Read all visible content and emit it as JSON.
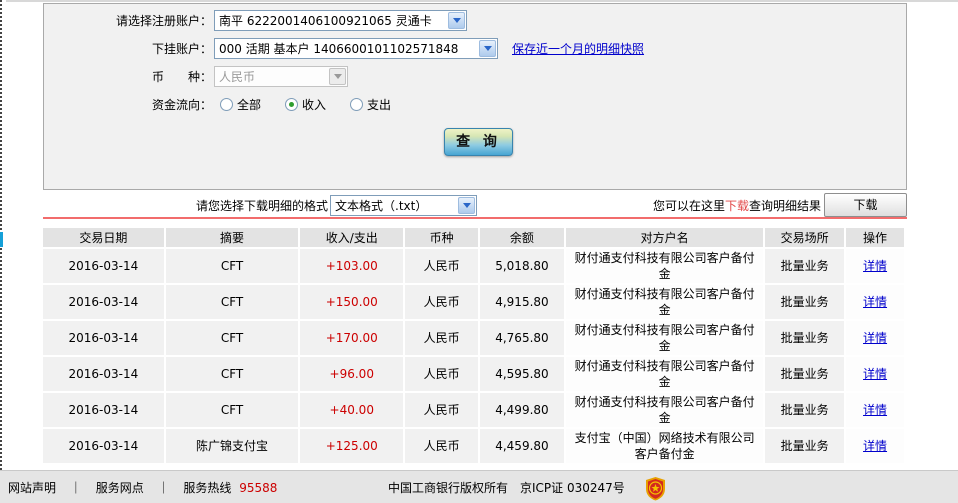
{
  "form": {
    "register_account_label": "请选择注册账户：",
    "register_account_value": "南平 6222001406100921065 灵通卡",
    "sub_account_label": "下挂账户：",
    "sub_account_value": "000 活期 基本户 1406600101102571848",
    "snapshot_link": "保存近一个月的明细快照",
    "currency_label": "币　　种：",
    "currency_value": "人民币",
    "flow_label": "资金流向：",
    "flow_options": [
      {
        "label": "全部",
        "selected": false
      },
      {
        "label": "收入",
        "selected": true
      },
      {
        "label": "支出",
        "selected": false
      }
    ],
    "query_button": "查 询"
  },
  "download": {
    "format_label": "请您选择下载明细的格式",
    "format_value": "文本格式（.txt）",
    "hint_prefix": "您可以在这里",
    "hint_link": "下载",
    "hint_suffix": "查询明细结果",
    "button_label": "下载"
  },
  "table": {
    "headers": [
      "交易日期",
      "摘要",
      "收入/支出",
      "币种",
      "余额",
      "对方户名",
      "交易场所",
      "操作"
    ],
    "detail_link": "详情",
    "rows": [
      {
        "date": "2016-03-14",
        "summary": "CFT",
        "amount": "+103.00",
        "currency": "人民币",
        "balance": "5,018.80",
        "counterparty": "财付通支付科技有限公司客户备付金",
        "venue": "批量业务"
      },
      {
        "date": "2016-03-14",
        "summary": "CFT",
        "amount": "+150.00",
        "currency": "人民币",
        "balance": "4,915.80",
        "counterparty": "财付通支付科技有限公司客户备付金",
        "venue": "批量业务"
      },
      {
        "date": "2016-03-14",
        "summary": "CFT",
        "amount": "+170.00",
        "currency": "人民币",
        "balance": "4,765.80",
        "counterparty": "财付通支付科技有限公司客户备付金",
        "venue": "批量业务"
      },
      {
        "date": "2016-03-14",
        "summary": "CFT",
        "amount": "+96.00",
        "currency": "人民币",
        "balance": "4,595.80",
        "counterparty": "财付通支付科技有限公司客户备付金",
        "venue": "批量业务"
      },
      {
        "date": "2016-03-14",
        "summary": "CFT",
        "amount": "+40.00",
        "currency": "人民币",
        "balance": "4,499.80",
        "counterparty": "财付通支付科技有限公司客户备付金",
        "venue": "批量业务"
      },
      {
        "date": "2016-03-14",
        "summary": "陈广锦支付宝",
        "amount": "+125.00",
        "currency": "人民币",
        "balance": "4,459.80",
        "counterparty": "支付宝（中国）网络技术有限公司客户备付金",
        "venue": "批量业务"
      }
    ]
  },
  "footer": {
    "link_statement": "网站声明",
    "link_branches": "服务网点",
    "separator": "｜",
    "hotline_label": "服务热线",
    "hotline_number": "95588",
    "copyright": "中国工商银行版权所有　京ICP证 030247号",
    "badge_icon": "security-shield-badge"
  },
  "colors": {
    "amount_red": "#cc0000",
    "link_blue": "#0000cc",
    "divider_red": "#f26c6c",
    "hotline_red": "#cc0000"
  }
}
